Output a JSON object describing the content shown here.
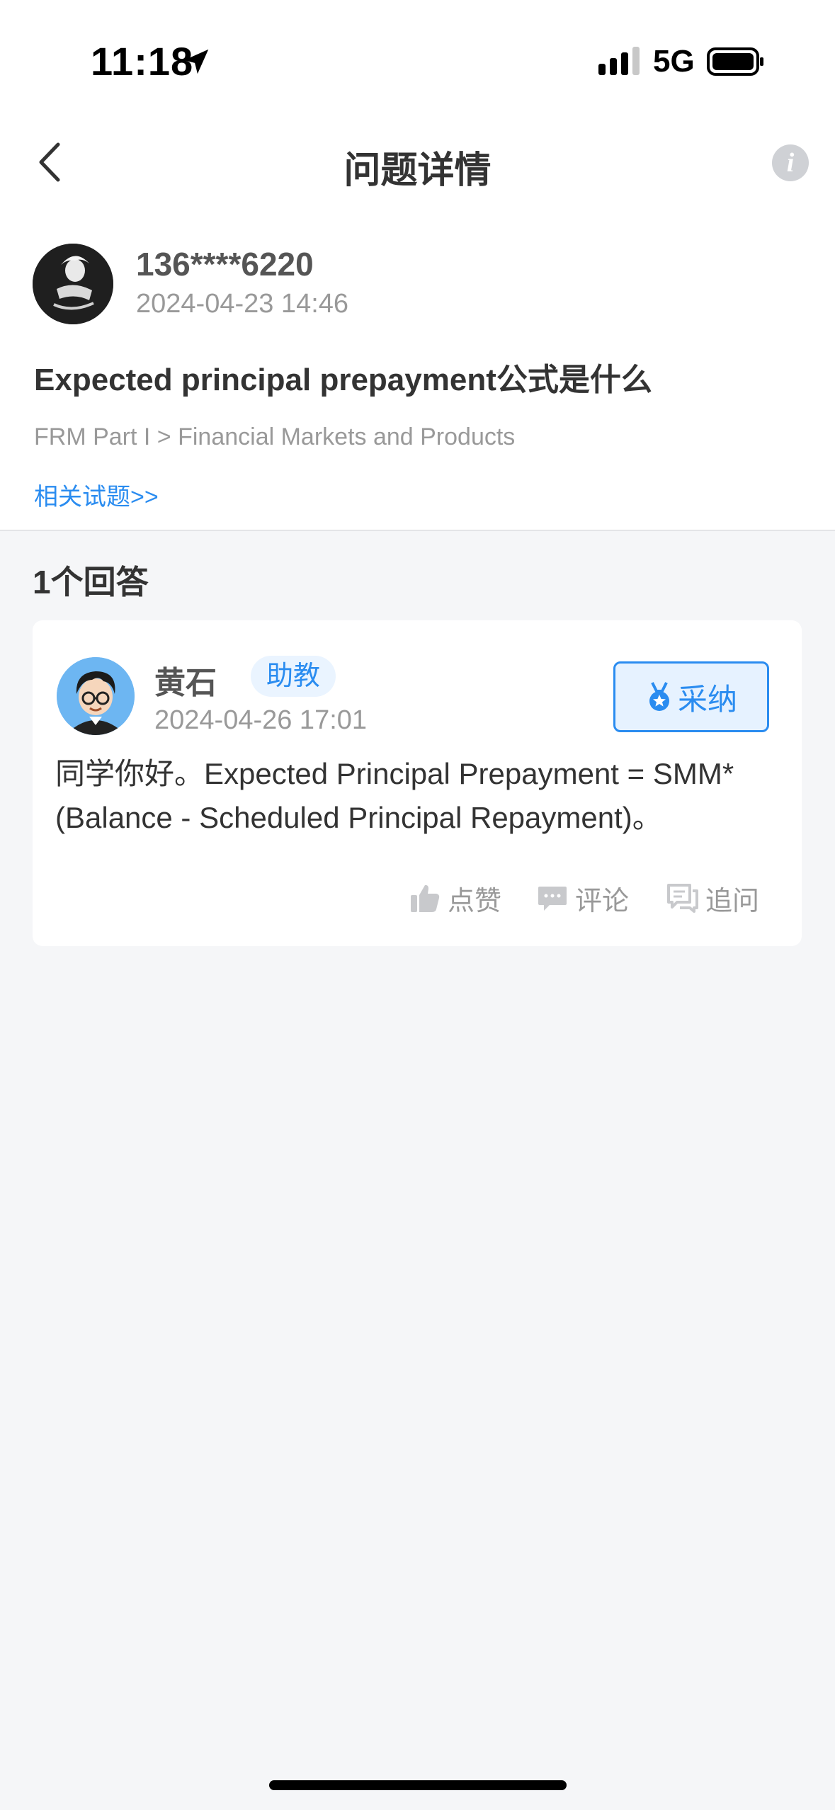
{
  "status_bar": {
    "time": "11:18",
    "network": "5G"
  },
  "header": {
    "title": "问题详情",
    "info_label": "i"
  },
  "question": {
    "asker_name": "136****6220",
    "time": "2024-04-23 14:46",
    "title": "Expected principal prepayment公式是什么",
    "category": "FRM Part I > Financial Markets and Products",
    "related_link": "相关试题>>"
  },
  "answers": {
    "heading": "1个回答",
    "items": [
      {
        "name": "黄石",
        "role": "助教",
        "time": "2024-04-26 17:01",
        "adopt_label": "采纳",
        "text": "同学你好。Expected Principal Prepayment = SMM*(Balance - Scheduled Principal Repayment)。",
        "actions": {
          "like": "点赞",
          "comment": "评论",
          "follow_up": "追问"
        }
      }
    ]
  },
  "colors": {
    "accent": "#2a8cf0",
    "background": "#f5f6f8",
    "muted_text": "#999999"
  },
  "icons": [
    "location-arrow-icon",
    "signal-icon",
    "battery-icon",
    "back-chevron-icon",
    "info-icon",
    "medal-icon",
    "thumbs-up-icon",
    "comment-icon",
    "follow-up-icon"
  ]
}
